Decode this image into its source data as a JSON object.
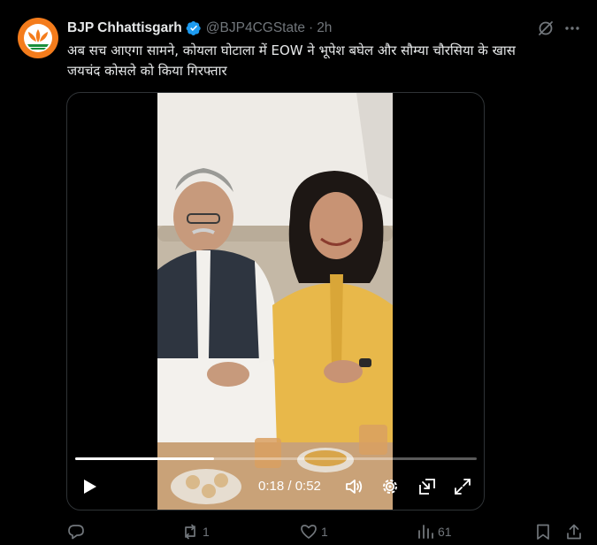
{
  "tweet": {
    "author_name": "BJP Chhattisgarh",
    "handle": "@BJP4CGState",
    "separator": "·",
    "time": "2h",
    "text": "अब सच आएगा सामने, कोयला घोटाला में EOW ने भूपेश बघेल और सौम्या चौरसिया के खास\nजयचंद कोसले को किया गिरफ्तार",
    "avatar_icon": "bjp-lotus-logo-icon",
    "verified_icon": "verified-badge-icon",
    "verified_color": "#1d9bf0"
  },
  "video": {
    "current_time": "0:18",
    "duration": "0:52",
    "time_display": "0:18 / 0:52",
    "progress_fraction": 0.346,
    "controls": [
      "play-icon",
      "volume-icon",
      "settings-icon",
      "pip-icon",
      "fullscreen-icon"
    ]
  },
  "actions": {
    "reply_count": "",
    "repost_count": "1",
    "like_count": "1",
    "views_count": "61"
  },
  "colors": {
    "background": "#000000",
    "text_primary": "#e7e9ea",
    "text_secondary": "#71767b",
    "border": "#2f3336",
    "brand_orange": "#f47c1c"
  }
}
